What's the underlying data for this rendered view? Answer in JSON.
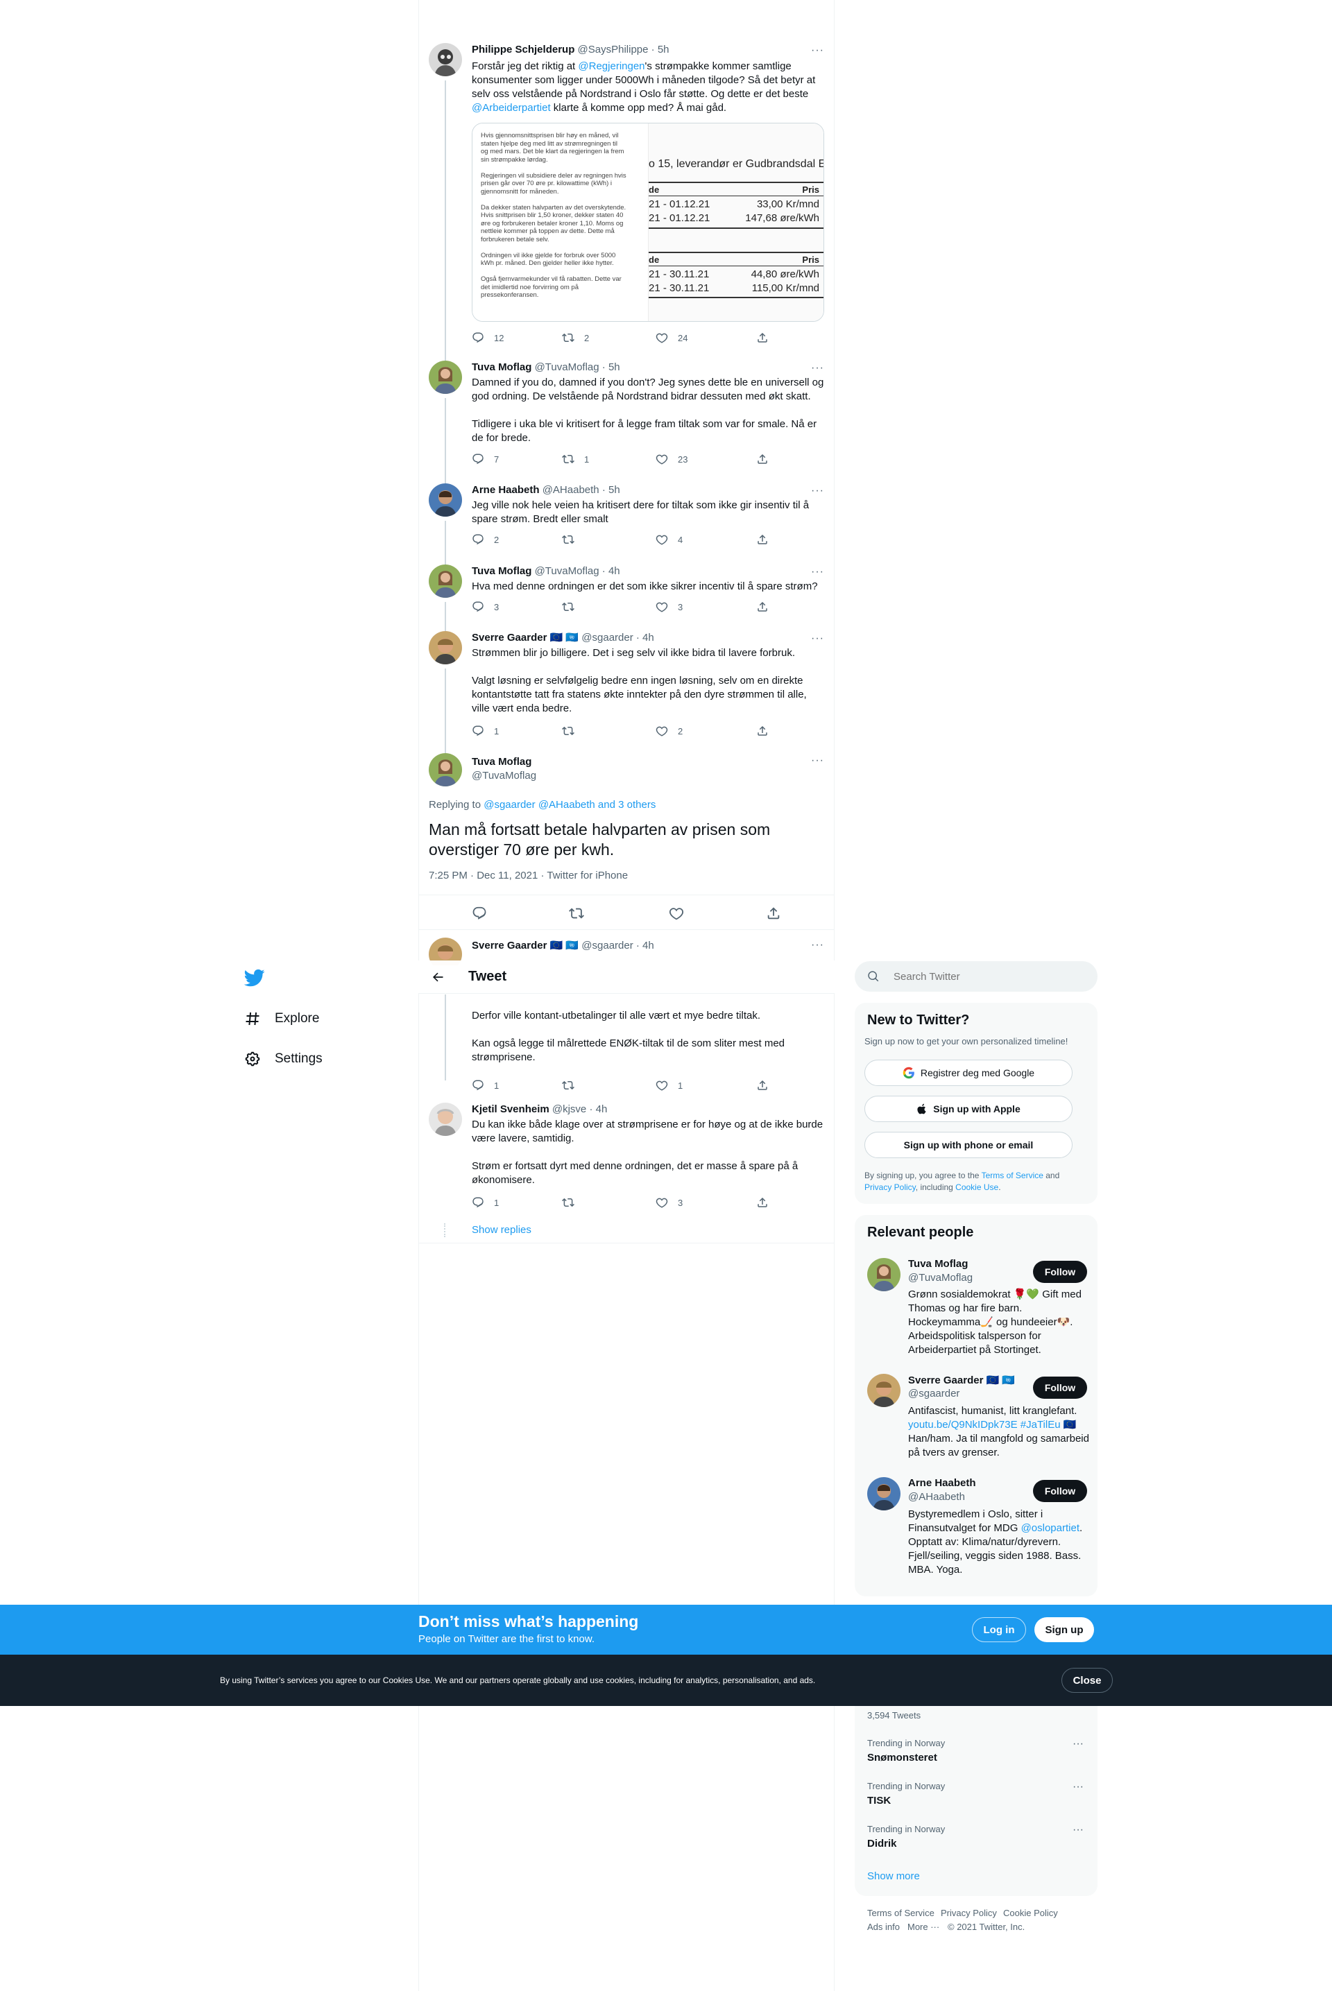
{
  "nav": {
    "explore": "Explore",
    "settings": "Settings"
  },
  "header": {
    "title": "Tweet"
  },
  "search": {
    "placeholder": "Search Twitter"
  },
  "tweets": [
    {
      "name": "Philippe Schjelderup",
      "handle": "@SaysPhilippe",
      "time": "· 5h",
      "text_parts": [
        "Forstår jeg det riktig at ",
        "@Regjeringen",
        "'s strømpakke kommer samtlige konsumenter som ligger under 5000Wh i måneden tilgode? Så det betyr at selv oss velstående på Nordstrand i Oslo får støtte. Og dette er det beste ",
        "@Arbeiderpartiet",
        " klarte å komme opp med? Å mai gåd."
      ],
      "replies": "12",
      "retweets": "2",
      "likes": "24"
    },
    {
      "name": "Tuva Moflag",
      "handle": "@TuvaMoflag",
      "time": "· 5h",
      "text": "Damned if you do, damned if you don't? Jeg synes dette ble en universell og god ordning. De velstående på Nordstrand bidrar dessuten med økt skatt.\n\nTidligere i uka ble vi kritisert for å legge fram tiltak som var for smale. Nå er de for brede.",
      "replies": "7",
      "retweets": "1",
      "likes": "23"
    },
    {
      "name": "Arne Haabeth",
      "handle": "@AHaabeth",
      "time": "· 5h",
      "text": "Jeg ville nok hele veien ha kritisert dere for tiltak som ikke gir insentiv til å spare strøm. Bredt eller smalt",
      "replies": "2",
      "retweets": "",
      "likes": "4"
    },
    {
      "name": "Tuva Moflag",
      "handle": "@TuvaMoflag",
      "time": "· 4h",
      "text": "Hva med denne ordningen er det som ikke sikrer incentiv til å spare strøm?",
      "replies": "3",
      "retweets": "",
      "likes": "3"
    },
    {
      "name": "Sverre Gaarder 🇪🇺 🇺🇳",
      "handle": "@sgaarder",
      "time": "· 4h",
      "text": "Strømmen blir jo billigere. Det i seg selv vil ikke bidra til lavere forbruk.\n\nValgt løsning er selvfølgelig  bedre enn ingen løsning, selv om en direkte kontantstøtte tatt fra statens økte inntekter på den dyre strømmen til alle, ville vært enda bedre.",
      "replies": "1",
      "retweets": "",
      "likes": "2"
    }
  ],
  "image_card": {
    "article": [
      "Hvis gjennomsnittsprisen blir høy en måned, vil",
      "staten hjelpe deg med litt av strømregningen til",
      "og med mars. Det ble klart da regjeringen la frem",
      "sin strømpakke lørdag.",
      "",
      "Regjeringen vil subsidiere deler av regningen hvis",
      "prisen går over 70 øre pr. kilowattime (kWh) i",
      "gjennomsnitt for måneden.",
      "",
      "Da dekker staten halvparten av det overskytende.",
      "Hvis snittprisen blir 1,50 kroner, dekker staten 40",
      "øre og forbrukeren betaler kroner 1,10. Moms og",
      "nettleie kommer på toppen av dette. Dette må",
      "forbrukeren betale selv.",
      "",
      "Ordningen vil ikke gjelde for forbruk over 5000",
      "kWh pr. måned. Den gjelder heller ikke hytter.",
      "",
      "Også fjernvarmekunder vil få rabatten. Dette var",
      "det imidlertid noe forvirring om på",
      "pressekonferansen."
    ],
    "bill_title": "o 15, leverandør er Gudbrandsdal E",
    "col_left": "de",
    "col_right": "Pris",
    "rows1": [
      [
        "21 - 01.12.21",
        "33,00 Kr/mnd"
      ],
      [
        "21 - 01.12.21",
        "147,68 øre/kWh"
      ]
    ],
    "rows2": [
      [
        "21 - 30.11.21",
        "44,80 øre/kWh"
      ],
      [
        "21 - 30.11.21",
        "115,00 Kr/mnd"
      ]
    ]
  },
  "main_tweet": {
    "name": "Tuva Moflag",
    "handle": "@TuvaMoflag",
    "replying_prefix": "Replying to ",
    "replying_to": "@sgaarder @AHaabeth and 3 others",
    "text": "Man må fortsatt betale halvparten av prisen som overstiger 70 øre per kwh.",
    "meta": "7:25 PM · Dec 11, 2021 · Twitter for iPhone"
  },
  "peek": {
    "name": "Sverre Gaarder 🇪🇺 🇺🇳",
    "handle": "@sgaarder",
    "time": "· 4h"
  },
  "continued": {
    "text": "Derfor ville kontant-utbetalinger til alle vært et mye bedre tiltak.\n\nKan også legge til målrettede ENØK-tiltak til de som sliter mest med strømprisene.",
    "replies": "1",
    "retweets": "",
    "likes": "1"
  },
  "kjetil": {
    "name": "Kjetil Svenheim",
    "handle": "@kjsve",
    "time": "· 4h",
    "text": "Du kan ikke både klage over at strømprisene er for høye og at de ikke burde være lavere, samtidig.\n\nStrøm er fortsatt dyrt med denne ordningen, det er masse å spare på å økonomisere.",
    "replies": "1",
    "retweets": "",
    "likes": "3"
  },
  "show_replies": "Show replies",
  "new_to_twitter": {
    "title": "New to Twitter?",
    "subtitle": "Sign up now to get your own personalized timeline!",
    "google": "Registrer deg med Google",
    "apple": "Sign up with Apple",
    "phone": "Sign up with phone or email",
    "terms_1": "By signing up, you agree to the ",
    "terms_link": "Terms of Service",
    "terms_2": " and",
    "privacy_link": "Privacy Policy",
    "terms_3": ", including ",
    "cookie_link": "Cookie Use",
    "terms_4": "."
  },
  "relevant": {
    "title": "Relevant people",
    "follow_label": "Follow",
    "people": [
      {
        "name": "Tuva Moflag",
        "handle": "@TuvaMoflag",
        "bio": "Grønn sosialdemokrat 🌹💚 Gift med Thomas og har fire barn. Hockeymamma🏒 og hundeeier🐶. Arbeidspolitisk talsperson for Arbeiderpartiet på Stortinget."
      },
      {
        "name": "Sverre Gaarder 🇪🇺 🇺🇳",
        "handle": "@sgaarder",
        "bio_1": "Antifascist, humanist, litt kranglefant.",
        "bio_link": "youtu.be/Q9NkIDpk73E #JaTilEu",
        "bio_flag": " 🇪🇺",
        "bio_2": "Han/ham. Ja til mangfold og samarbeid på tvers av grenser."
      },
      {
        "name": "Arne Haabeth",
        "handle": "@AHaabeth",
        "bio_1": "Bystyremedlem i Oslo, sitter i Finansutvalget for MDG ",
        "bio_link": "@oslopartiet",
        "bio_2": ". Opptatt av: Klima/natur/dyrevern. Fjell/seiling, veggis siden 1988. Bass. MBA. Yoga."
      }
    ]
  },
  "banner": {
    "title": "Don’t miss what’s happening",
    "subtitle": "People on Twitter are the first to know.",
    "login": "Log in",
    "signup": "Sign up"
  },
  "cookie": {
    "text": "By using Twitter’s services you agree to our Cookies Use. We and our partners operate globally and use cookies, including for analytics, personalisation, and ads.",
    "close": "Close"
  },
  "trends": {
    "count": "3,594 Tweets",
    "items": [
      {
        "label": "Trending in Norway",
        "name": "Snømonsteret"
      },
      {
        "label": "Trending in Norway",
        "name": "TISK"
      },
      {
        "label": "Trending in Norway",
        "name": "Didrik"
      }
    ],
    "show_more": "Show more"
  },
  "footer": {
    "terms": "Terms of Service",
    "privacy": "Privacy Policy",
    "cookie": "Cookie Policy",
    "ads": "Ads info",
    "more": "More ···",
    "copyright": "© 2021 Twitter, Inc."
  },
  "colors": {
    "accent": "#1d9bf0",
    "text": "#0f1419",
    "muted": "#536471",
    "cookie_bar": "#15202b"
  }
}
